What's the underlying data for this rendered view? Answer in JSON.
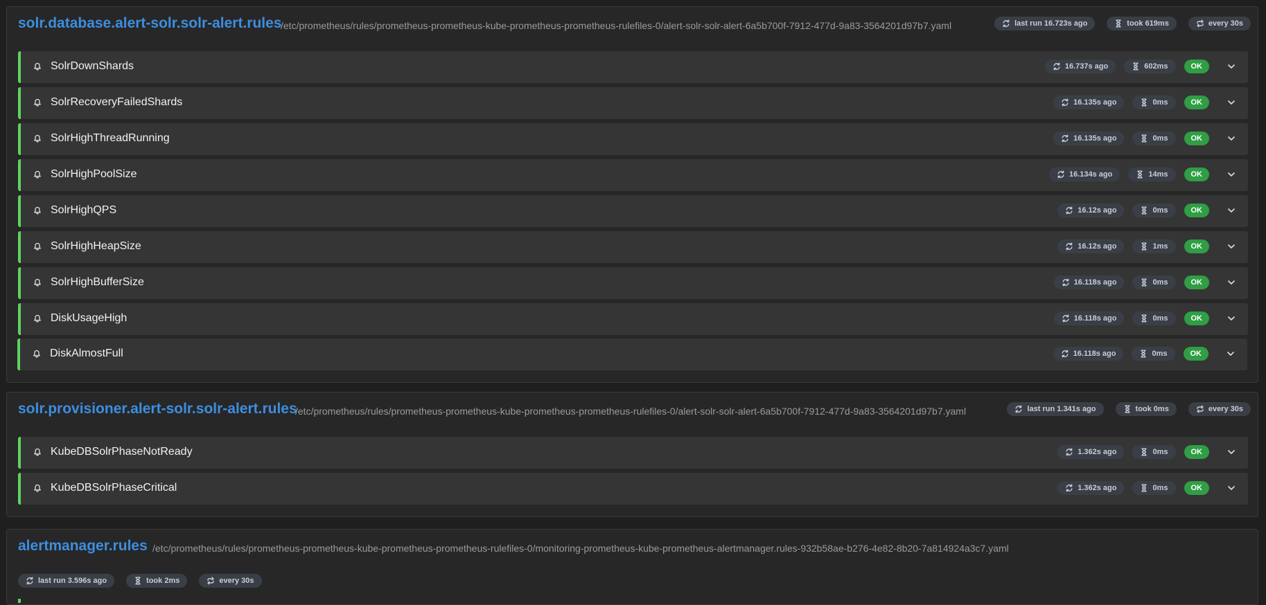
{
  "groups": [
    {
      "title": "solr.database.alert-solr.solr-alert.rules",
      "file": "/etc/prometheus/rules/prometheus-prometheus-kube-prometheus-prometheus-rulefiles-0/alert-solr-solr-alert-6a5b700f-7912-477d-9a83-3564201d97b7.yaml",
      "last_run": "last run 16.723s ago",
      "took": "took 619ms",
      "interval": "every 30s",
      "rules": [
        {
          "name": "SolrDownShards",
          "ago": "16.737s ago",
          "took": "602ms",
          "state": "OK"
        },
        {
          "name": "SolrRecoveryFailedShards",
          "ago": "16.135s ago",
          "took": "0ms",
          "state": "OK"
        },
        {
          "name": "SolrHighThreadRunning",
          "ago": "16.135s ago",
          "took": "0ms",
          "state": "OK"
        },
        {
          "name": "SolrHighPoolSize",
          "ago": "16.134s ago",
          "took": "14ms",
          "state": "OK"
        },
        {
          "name": "SolrHighQPS",
          "ago": "16.12s ago",
          "took": "0ms",
          "state": "OK"
        },
        {
          "name": "SolrHighHeapSize",
          "ago": "16.12s ago",
          "took": "1ms",
          "state": "OK"
        },
        {
          "name": "SolrHighBufferSize",
          "ago": "16.118s ago",
          "took": "0ms",
          "state": "OK"
        },
        {
          "name": "DiskUsageHigh",
          "ago": "16.118s ago",
          "took": "0ms",
          "state": "OK"
        },
        {
          "name": "DiskAlmostFull",
          "ago": "16.118s ago",
          "took": "0ms",
          "state": "OK"
        }
      ]
    },
    {
      "title": "solr.provisioner.alert-solr.solr-alert.rules",
      "file": "/etc/prometheus/rules/prometheus-prometheus-kube-prometheus-prometheus-rulefiles-0/alert-solr-solr-alert-6a5b700f-7912-477d-9a83-3564201d97b7.yaml",
      "last_run": "last run 1.341s ago",
      "took": "took 0ms",
      "interval": "every 30s",
      "rules": [
        {
          "name": "KubeDBSolrPhaseNotReady",
          "ago": "1.362s ago",
          "took": "0ms",
          "state": "OK"
        },
        {
          "name": "KubeDBSolrPhaseCritical",
          "ago": "1.362s ago",
          "took": "0ms",
          "state": "OK"
        }
      ]
    },
    {
      "title": "alertmanager.rules",
      "file": "/etc/prometheus/rules/prometheus-prometheus-kube-prometheus-prometheus-rulefiles-0/monitoring-prometheus-kube-prometheus-alertmanager.rules-932b58ae-b276-4e82-8b20-7a814924a3c7.yaml",
      "last_run": "last run 3.596s ago",
      "took": "took 2ms",
      "interval": "every 30s",
      "rules": []
    }
  ],
  "colors": {
    "accent": "#3d8ee0",
    "ok": "#2f9e44",
    "rule_border": "#5fd35f"
  },
  "icons": {
    "last_run": "refresh-icon",
    "took": "hourglass-icon",
    "interval": "repeat-icon",
    "rule": "bell-icon",
    "expand": "chevron-down-icon"
  }
}
